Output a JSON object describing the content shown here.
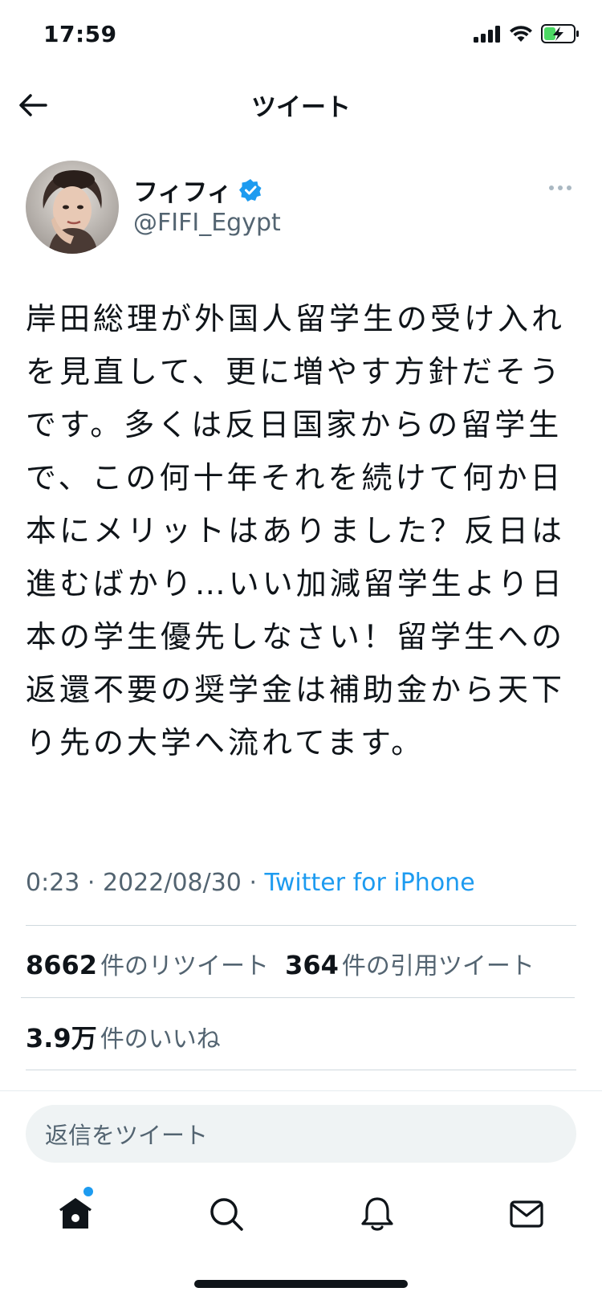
{
  "status_bar": {
    "time": "17:59"
  },
  "header": {
    "title": "ツイート"
  },
  "author": {
    "display_name": "フィフィ",
    "handle": "@FIFI_Egypt",
    "verified": true
  },
  "tweet": {
    "text": "岸田総理が外国人留学生の受け入れを見直して、更に増やす方針だそうです。多くは反日国家からの留学生で、この何十年それを続けて何か日本にメリットはありました？反日は進むばかり…いい加減留学生より日本の学生優先しなさい！留学生への返還不要の奨学金は補助金から天下り先の大学へ流れてます。",
    "time": "0:23",
    "separator": " · ",
    "date": "2022/08/30",
    "source": "Twitter for iPhone"
  },
  "stats": {
    "retweets_count": "8662",
    "retweets_label": "件のリツイート",
    "quotes_count": "364",
    "quotes_label": "件の引用ツイート",
    "likes_count": "3.9万",
    "likes_label": "件のいいね"
  },
  "reply": {
    "placeholder": "返信をツイート"
  },
  "tabs": [
    {
      "icon": "home-icon",
      "active": true,
      "has_notification_dot": true
    },
    {
      "icon": "search-icon",
      "active": false
    },
    {
      "icon": "bell-icon",
      "active": false
    },
    {
      "icon": "mail-icon",
      "active": false
    }
  ],
  "colors": {
    "accent": "#1d9bf0",
    "text_primary": "#0f1419",
    "text_secondary": "#536471",
    "divider": "#cfd9de",
    "reply_bg": "#eff3f4",
    "battery_fill": "#4cd964"
  }
}
